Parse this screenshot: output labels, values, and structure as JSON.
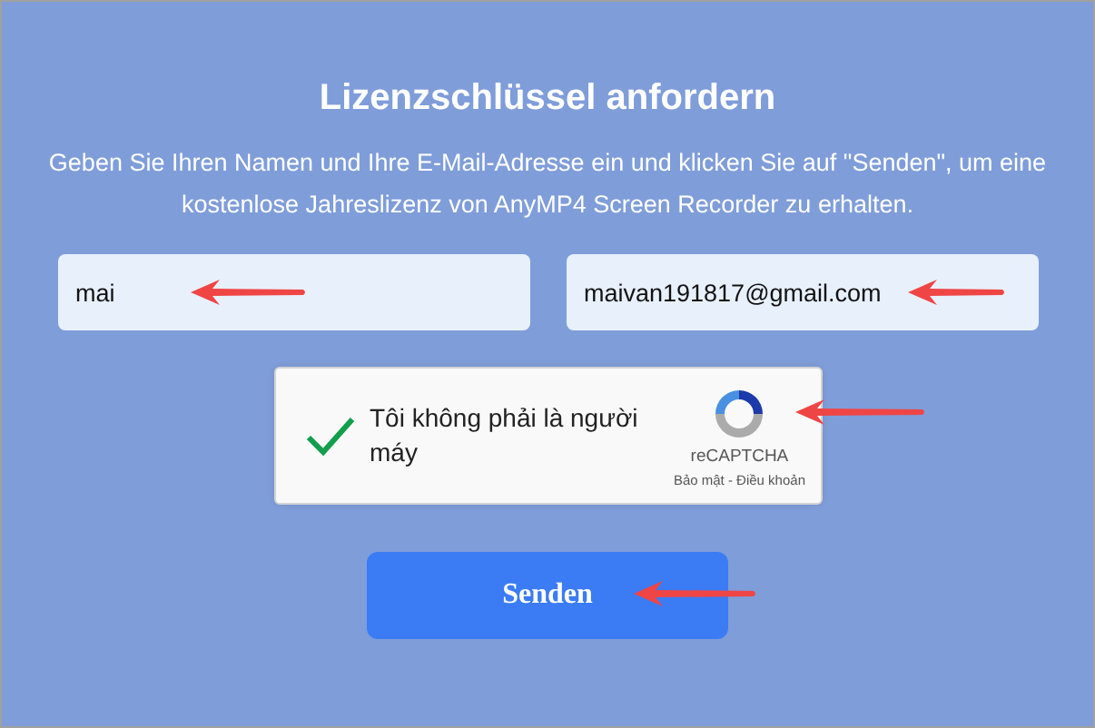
{
  "title": "Lizenzschlüssel anfordern",
  "description": "Geben Sie Ihren Namen und Ihre E-Mail-Adresse ein und klicken Sie auf \"Senden\", um eine kostenlose Jahreslizenz von AnyMP4 Screen Recorder zu erhalten.",
  "fields": [
    {
      "value": "mai"
    },
    {
      "value": "maivan191817@gmail.com"
    }
  ],
  "captcha": {
    "label": "Tôi không phải là người máy",
    "checked": true,
    "brand": "reCAPTCHA",
    "links": "Bảo mật - Điều khoản"
  },
  "submit": {
    "label": "Senden"
  }
}
